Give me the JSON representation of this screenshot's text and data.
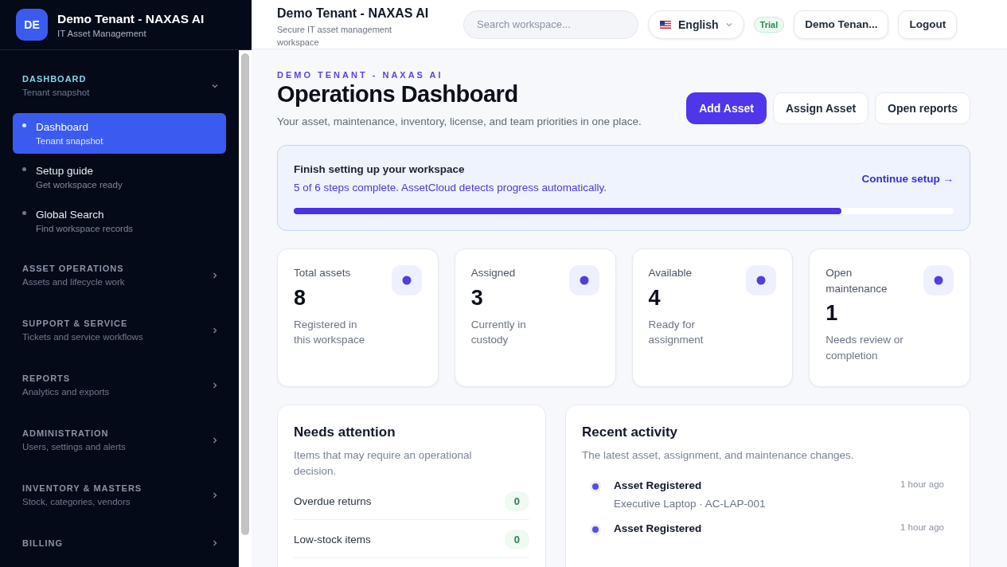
{
  "sidebar": {
    "avatar": "DE",
    "title": "Demo Tenant - NAXAS AI",
    "subtitle": "IT Asset Management",
    "groups": [
      {
        "label": "DASHBOARD",
        "hint": "Tenant snapshot",
        "expanded": true,
        "items": [
          {
            "label": "Dashboard",
            "hint": "Tenant snapshot",
            "selected": true
          },
          {
            "label": "Setup guide",
            "hint": "Get workspace ready",
            "selected": false
          },
          {
            "label": "Global Search",
            "hint": "Find workspace records",
            "selected": false
          }
        ]
      },
      {
        "label": "ASSET OPERATIONS",
        "hint": "Assets and lifecycle work",
        "expanded": false
      },
      {
        "label": "SUPPORT & SERVICE",
        "hint": "Tickets and service workflows",
        "expanded": false
      },
      {
        "label": "REPORTS",
        "hint": "Analytics and exports",
        "expanded": false
      },
      {
        "label": "ADMINISTRATION",
        "hint": "Users, settings and alerts",
        "expanded": false
      },
      {
        "label": "INVENTORY & MASTERS",
        "hint": "Stock, categories, vendors",
        "expanded": false
      },
      {
        "label": "BILLING",
        "expanded": false
      }
    ]
  },
  "topbar": {
    "title": "Demo Tenant - NAXAS AI",
    "subtitle": "Secure IT asset management workspace",
    "search": {
      "placeholder": "Search workspace..."
    },
    "language": "English",
    "plan_badge": "Trial",
    "account": "Demo Tenan...",
    "logout": "Logout"
  },
  "header": {
    "eyebrow": "DEMO TENANT - NAXAS AI",
    "title": "Operations Dashboard",
    "description": "Your asset, maintenance, inventory, license, and team priorities in one place.",
    "buttons": [
      {
        "label": "Add Asset",
        "kind": "primary"
      },
      {
        "label": "Assign Asset",
        "kind": "secondary"
      },
      {
        "label": "Open reports",
        "kind": "secondary"
      }
    ]
  },
  "setup": {
    "title": "Finish setting up your workspace",
    "status": "5 of 6 steps complete. AssetCloud detects progress automatically.",
    "link": "Continue setup →",
    "level": 0.83
  },
  "stats": [
    {
      "label": "Total assets",
      "value": "8",
      "note": "Registered in this workspace"
    },
    {
      "label": "Assigned",
      "value": "3",
      "note": "Currently in custody"
    },
    {
      "label": "Available",
      "value": "4",
      "note": "Ready for assignment"
    },
    {
      "label": "Open maintenance",
      "value": "1",
      "note": "Needs review or completion"
    }
  ],
  "attention": {
    "title": "Needs attention",
    "description": "Items that may require an operational decision.",
    "rows": [
      {
        "label": "Overdue returns",
        "count": "0"
      },
      {
        "label": "Low-stock items",
        "count": "0"
      }
    ]
  },
  "activity": {
    "title": "Recent activity",
    "description": "The latest asset, assignment, and maintenance changes.",
    "events": [
      {
        "title": "Asset Registered",
        "detail": "Executive Laptop · AC-LAP-001",
        "time": "1 hour ago"
      },
      {
        "title": "Asset Registered",
        "time": "1 hour ago"
      }
    ]
  }
}
